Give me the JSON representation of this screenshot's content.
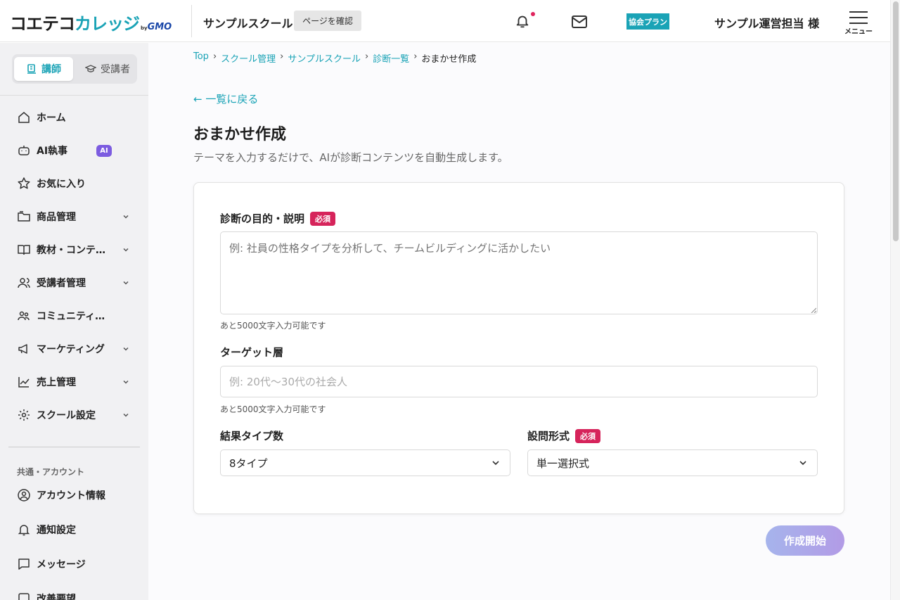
{
  "header": {
    "logo_main": "コエテコ",
    "logo_accent": "カレッジ",
    "logo_by": "by",
    "logo_brand": "GMO",
    "school_name": "サンプルスクール",
    "page_check_label": "ページを確認",
    "plan_badge": "協会プラン",
    "user_name": "サンプル運営担当 様",
    "menu_label": "メニュー"
  },
  "sidebar": {
    "roles": [
      {
        "label": "講師",
        "active": true
      },
      {
        "label": "受講者",
        "active": false
      }
    ],
    "items": [
      {
        "label": "ホーム",
        "icon": "home-icon"
      },
      {
        "label": "AI執事",
        "icon": "robot-icon",
        "badge": "AI"
      },
      {
        "label": "お気に入り",
        "icon": "star-icon"
      },
      {
        "label": "商品管理",
        "icon": "folder-icon"
      },
      {
        "label": "教材・コンテンツ",
        "icon": "book-icon"
      },
      {
        "label": "受講者管理",
        "icon": "users-icon"
      },
      {
        "label": "コミュニティ管理",
        "icon": "community-icon"
      },
      {
        "label": "マーケティング",
        "icon": "megaphone-icon"
      },
      {
        "label": "売上管理",
        "icon": "chart-icon"
      },
      {
        "label": "スクール設定",
        "icon": "gear-icon"
      }
    ],
    "section_label": "共通・アカウント",
    "account_items": [
      {
        "label": "アカウント情報",
        "icon": "account-icon"
      },
      {
        "label": "通知設定",
        "icon": "bell-icon"
      },
      {
        "label": "メッセージ",
        "icon": "message-icon"
      },
      {
        "label": "改善要望",
        "icon": "feedback-icon"
      }
    ]
  },
  "breadcrumb": {
    "items": [
      "Top",
      "スクール管理",
      "サンプルスクール",
      "診断一覧"
    ],
    "current": "おまかせ作成",
    "separator": "›"
  },
  "main": {
    "back_link": "← 一覧に戻る",
    "title": "おまかせ作成",
    "description": "テーマを入力するだけで、AIが診断コンテンツを自動生成します。"
  },
  "form": {
    "purpose_label": "診断の目的・説明",
    "required_label": "必須",
    "purpose_placeholder": "例: 社員の性格タイプを分析して、チームビルディングに活かしたい",
    "purpose_helper": "あと5000文字入力可能です",
    "target_label": "ターゲット層",
    "target_placeholder": "例: 20代〜30代の社会人",
    "target_helper": "あと5000文字入力可能です",
    "result_types_label": "結果タイプ数",
    "result_types_value": "8タイプ",
    "question_format_label": "設問形式",
    "question_format_value": "単一選択式",
    "submit_label": "作成開始"
  },
  "colors": {
    "accent": "#1aa3b6",
    "required": "#d6245b",
    "ai_badge": "#7c5ce0"
  }
}
